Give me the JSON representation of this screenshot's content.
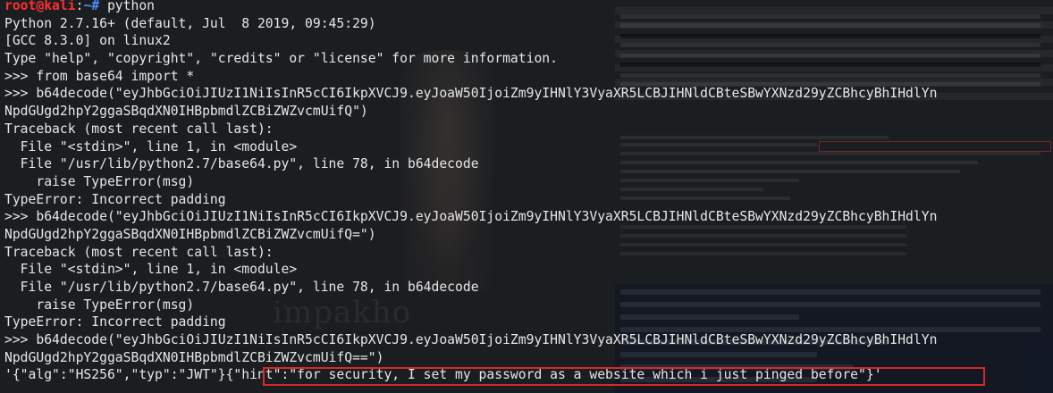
{
  "terminal": {
    "prompt": {
      "user_host": "root@kali",
      "separator": ":",
      "path_symbol": "~# ",
      "command": "python"
    },
    "lines": [
      "Python 2.7.16+ (default, Jul  8 2019, 09:45:29)",
      "[GCC 8.3.0] on linux2",
      "Type \"help\", \"copyright\", \"credits\" or \"license\" for more information.",
      ">>> from base64 import *",
      ">>> b64decode(\"eyJhbGciOiJIUzI1NiIsInR5cCI6IkpXVCJ9.eyJoaW50IjoiZm9yIHNlY3VyaXR5LCBJIHNldCBteSBwYXNzd29yZCBhcyBhIHdlYn",
      "NpdGUgd2hpY2ggaSBqdXN0IHBpbmdlZCBiZWZvcmUifQ\")",
      "Traceback (most recent call last):",
      "  File \"<stdin>\", line 1, in <module>",
      "  File \"/usr/lib/python2.7/base64.py\", line 78, in b64decode",
      "    raise TypeError(msg)",
      "TypeError: Incorrect padding",
      ">>> b64decode(\"eyJhbGciOiJIUzI1NiIsInR5cCI6IkpXVCJ9.eyJoaW50IjoiZm9yIHNlY3VyaXR5LCBJIHNldCBteSBwYXNzd29yZCBhcyBhIHdlYn",
      "NpdGUgd2hpY2ggaSBqdXN0IHBpbmdlZCBiZWZvcmUifQ=\")",
      "Traceback (most recent call last):",
      "  File \"<stdin>\", line 1, in <module>",
      "  File \"/usr/lib/python2.7/base64.py\", line 78, in b64decode",
      "    raise TypeError(msg)",
      "TypeError: Incorrect padding",
      ">>> b64decode(\"eyJhbGciOiJIUzI1NiIsInR5cCI6IkpXVCJ9.eyJoaW50IjoiZm9yIHNlY3VyaXR5LCBJIHNldCBteSBwYXNzd29yZCBhcyBhIHdlYn",
      "NpdGUgd2hpY2ggaSBqdXN0IHBpbmdlZCBiZWZvcmUifQ==\")",
      "'{\"alg\":\"HS256\",\"typ\":\"JWT\"}{\"hint\":\"for security, I set my password as a website which i just pinged before\"}'"
    ]
  },
  "background": {
    "watermark_text": "impakho"
  },
  "colors": {
    "terminal_bg": "#1b1e21",
    "text": "#e6e6e6",
    "prompt_user": "#ff2e2e",
    "prompt_path": "#4f8cff",
    "highlight_border": "#d42a2a"
  }
}
